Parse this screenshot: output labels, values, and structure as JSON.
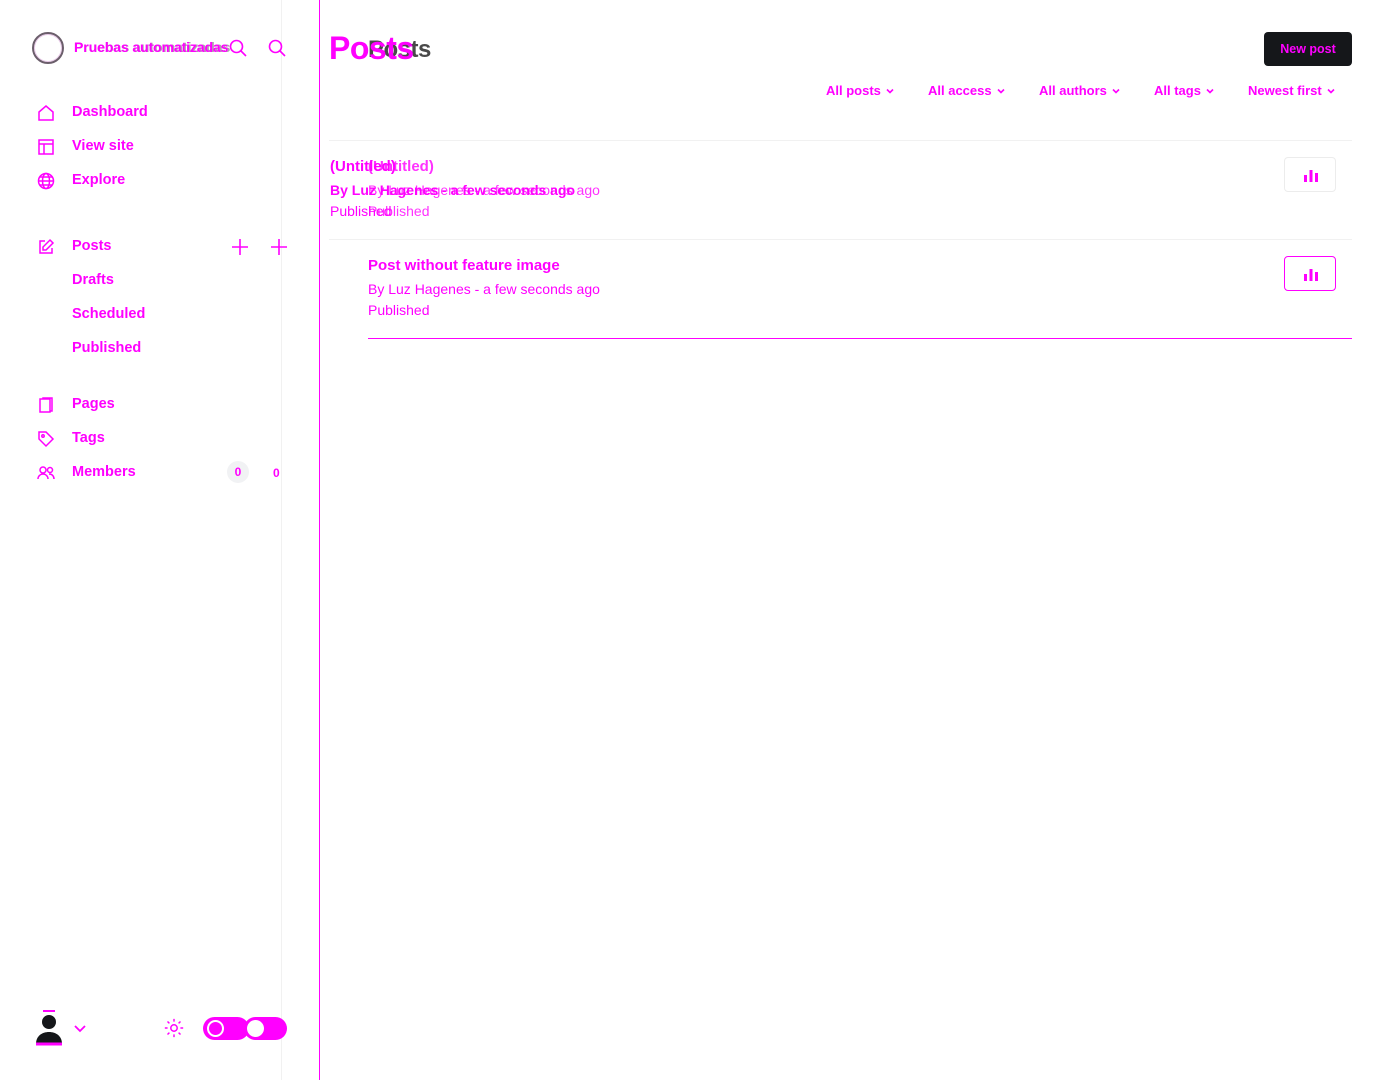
{
  "site": {
    "title": "Pruebas automatizadas",
    "title_overlay": "Pruebas automatizadas"
  },
  "sidebar": {
    "primary": [
      {
        "label": "Dashboard",
        "icon": "home-icon"
      },
      {
        "label": "View site",
        "icon": "layout-icon"
      },
      {
        "label": "Explore",
        "icon": "globe-icon"
      }
    ],
    "posts": {
      "label": "Posts",
      "icon": "edit-icon",
      "sub": [
        "Drafts",
        "Scheduled",
        "Published"
      ]
    },
    "secondary": [
      {
        "label": "Pages",
        "icon": "page-icon"
      },
      {
        "label": "Tags",
        "icon": "tag-icon"
      },
      {
        "label": "Members",
        "icon": "members-icon",
        "count": "0",
        "count2": "0"
      }
    ]
  },
  "main": {
    "title": "Posts",
    "title_overlay": "Posts",
    "new_post_label": "New post",
    "filters": [
      "All posts",
      "All access",
      "All authors",
      "All tags",
      "Newest first"
    ],
    "posts": [
      {
        "title": "(Untitled)",
        "title_overlay": "(Untitled)",
        "meta": "By Luz Hagenes - a few seconds ago",
        "status": "Published"
      },
      {
        "title": "Post without feature image",
        "meta": "By Luz Hagenes - a few seconds ago",
        "status": "Published"
      }
    ]
  },
  "colors": {
    "accent": "#ff00ff",
    "button_bg": "#15171a"
  }
}
